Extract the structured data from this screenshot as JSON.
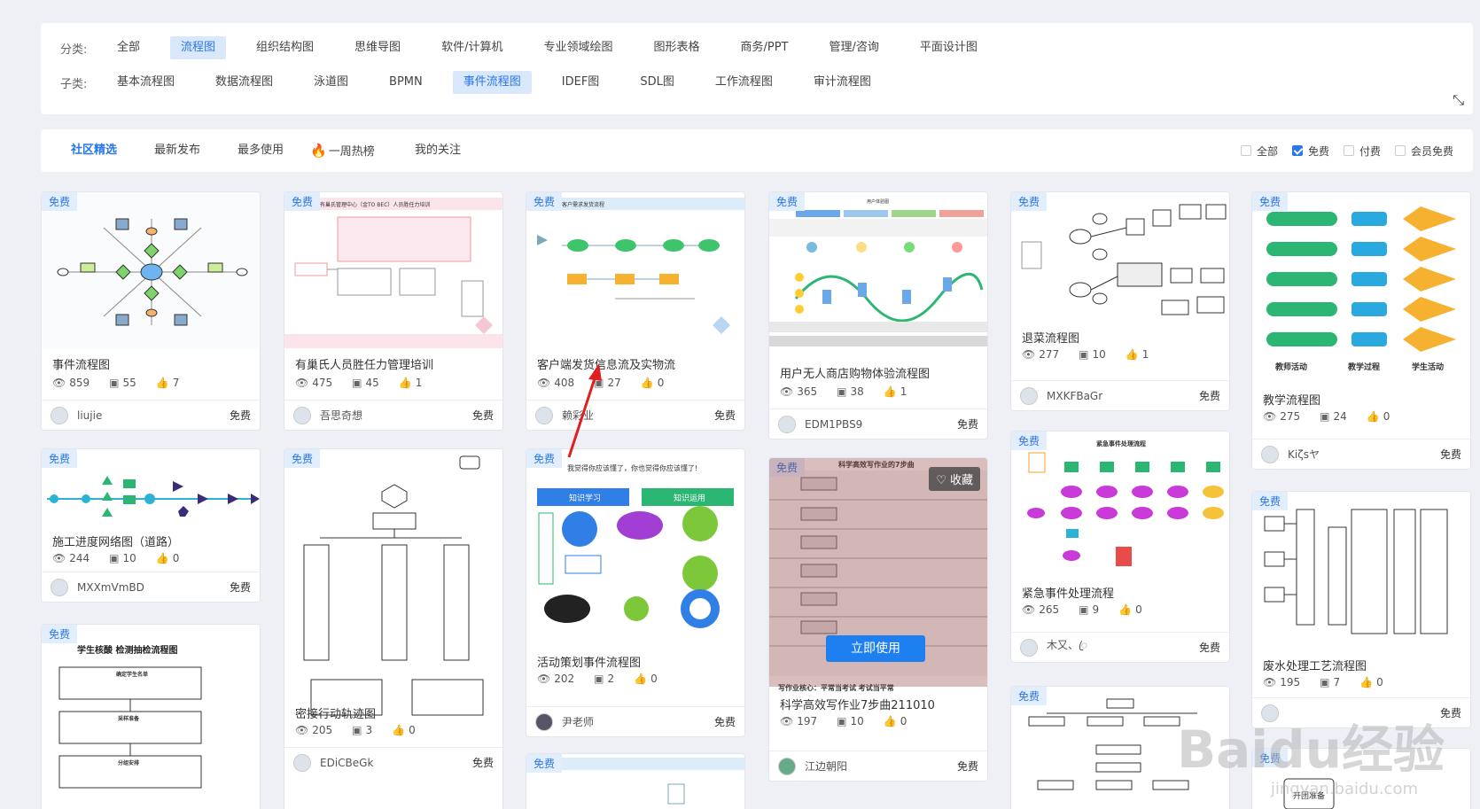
{
  "filters": {
    "category_label": "分类:",
    "categories": [
      "全部",
      "流程图",
      "组织结构图",
      "思维导图",
      "软件/计算机",
      "专业领域绘图",
      "图形表格",
      "商务/PPT",
      "管理/咨询",
      "平面设计图"
    ],
    "sub_label": "子类:",
    "subcategories": [
      "基本流程图",
      "数据流程图",
      "泳道图",
      "BPMN",
      "事件流程图",
      "IDEF图",
      "SDL图",
      "工作流程图",
      "审计流程图"
    ]
  },
  "tabs": [
    "社区精选",
    "最新发布",
    "最多使用",
    "一周热榜",
    "我的关注"
  ],
  "price_filters": [
    "全部",
    "免费",
    "付费",
    "会员免费"
  ],
  "badge_label": "免费",
  "cards": [
    {
      "title": "事件流程图",
      "views": "859",
      "copies": "55",
      "likes": "7",
      "author": "liujie",
      "price": "免费"
    },
    {
      "title": "有巢氏人员胜任力管理培训",
      "views": "475",
      "copies": "45",
      "likes": "1",
      "author": "吾思奇想",
      "price": "免费"
    },
    {
      "title": "客户端发货信息流及实物流",
      "views": "408",
      "copies": "27",
      "likes": "0",
      "author": "赖彩业",
      "price": "免费"
    },
    {
      "title": "用户无人商店购物体验流程图",
      "views": "365",
      "copies": "38",
      "likes": "1",
      "author": "EDM1PBS9",
      "price": "免费"
    },
    {
      "title": "退菜流程图",
      "views": "277",
      "copies": "10",
      "likes": "1",
      "author": "MXKFBaGr",
      "price": "免费"
    },
    {
      "title": "教学流程图",
      "views": "275",
      "copies": "24",
      "likes": "0",
      "author": "Kiζsヤ",
      "price": "免费"
    },
    {
      "title": "施工进度网络图（道路）",
      "views": "244",
      "copies": "10",
      "likes": "0",
      "author": "MXXmVmBD",
      "price": "免费"
    },
    {
      "title": "密接行动轨迹图",
      "views": "205",
      "copies": "3",
      "likes": "0",
      "author": "EDiCBeGk",
      "price": "免费"
    },
    {
      "title": "活动策划事件流程图",
      "views": "202",
      "copies": "2",
      "likes": "0",
      "author": "尹老师",
      "price": "免费"
    },
    {
      "title": "科学高效写作业7步曲211010",
      "views": "197",
      "copies": "10",
      "likes": "0",
      "author": "江边朝阳",
      "price": "免费"
    },
    {
      "title": "紧急事件处理流程",
      "views": "265",
      "copies": "9",
      "likes": "0",
      "author": "木又、ꦿ",
      "price": "免费"
    },
    {
      "title": "废水处理工艺流程图",
      "views": "195",
      "copies": "7",
      "likes": "0",
      "author": "",
      "price": "免费"
    },
    {
      "title": "学生核酸检测抽检流程图",
      "views": "",
      "copies": "",
      "likes": "",
      "author": "",
      "price": ""
    }
  ],
  "thumb_texts": {
    "card2_header": "有巢氏管理中心（金TO BEC）人员胜任力培训",
    "card3_header": "客户需求发货流程",
    "card4_header": "用户体验图",
    "card9_header": "我觉得你应该懂了，你也觉得你应该懂了!",
    "card9_left": "知识学习",
    "card9_right": "知识运用",
    "card10_header": "科学高效写作业的7步曲",
    "card10_footer": "写作业核心：平常当考试  考试当平常",
    "card11_header": "紧急事件处理流程",
    "card13_header": "学生核酸 检测抽检流程图",
    "card13_steps": [
      "确定学生名单",
      "采样准备",
      "分组安排"
    ],
    "card6_labels": [
      "教师活动",
      "教学过程",
      "学生活动"
    ],
    "card15_box": "开团准备"
  },
  "overlay": {
    "use_button": "立即使用",
    "fav_button": "收藏"
  },
  "watermark": {
    "main": "Baidu经验",
    "sub": "jingyan.baidu.com"
  },
  "icons": {
    "views": "eye-icon",
    "copies": "copy-icon",
    "likes": "thumbs-up-icon",
    "fire": "fire-icon",
    "expand": "expand-icon",
    "heart": "heart-icon"
  }
}
